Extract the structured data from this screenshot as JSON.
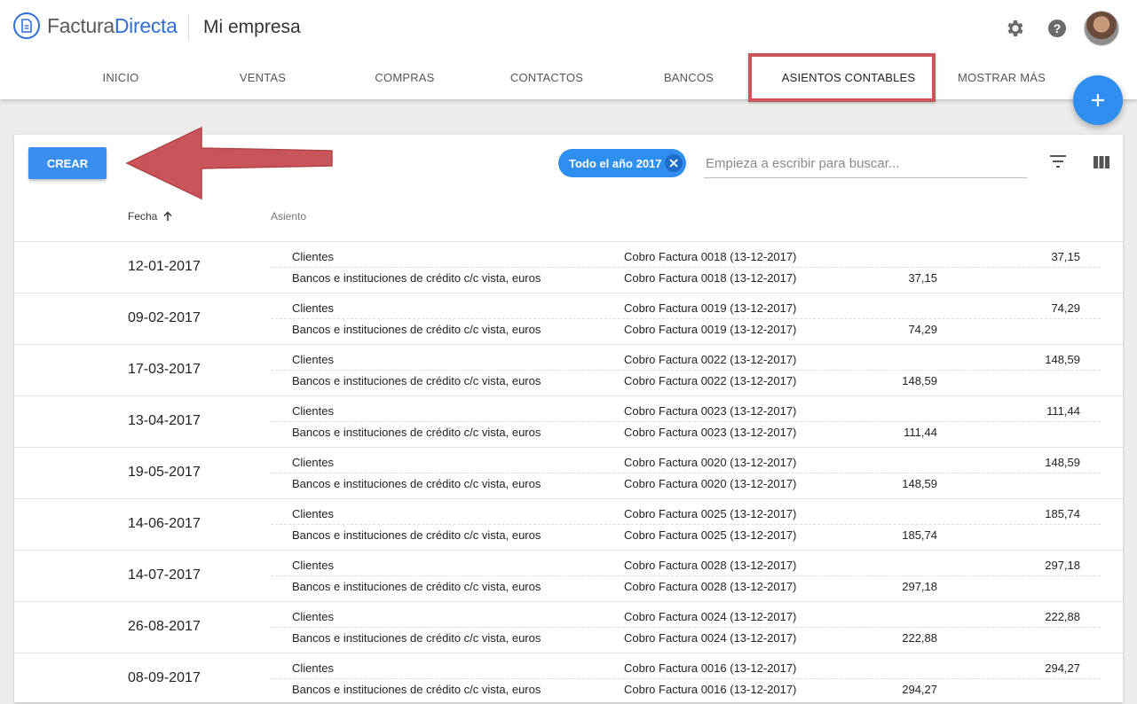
{
  "app": {
    "logo_part1": "Factura",
    "logo_part2": "Directa",
    "company": "Mi empresa"
  },
  "header_icons": [
    "settings-icon",
    "help-icon",
    "avatar"
  ],
  "tabs": [
    {
      "label": "INICIO"
    },
    {
      "label": "VENTAS"
    },
    {
      "label": "COMPRAS"
    },
    {
      "label": "CONTACTOS"
    },
    {
      "label": "BANCOS"
    },
    {
      "label": "ASIENTOS CONTABLES"
    },
    {
      "label": "MOSTRAR MÁS"
    }
  ],
  "active_tab": "ASIENTOS CONTABLES",
  "toolbar": {
    "create_label": "CREAR",
    "filter_chip": "Todo el año 2017",
    "search_placeholder": "Empieza a escribir para buscar..."
  },
  "columns": {
    "fecha": "Fecha",
    "asiento": "Asiento"
  },
  "colors": {
    "accent": "#2f8ff0",
    "annotation": "#c9555a"
  },
  "entries": [
    {
      "date": "12-01-2017",
      "lines": [
        {
          "account": "Clientes",
          "desc": "Cobro Factura 0018 (13-12-2017)",
          "debe": "",
          "haber": "37,15"
        },
        {
          "account": "Bancos e instituciones de crédito c/c vista, euros",
          "desc": "Cobro Factura 0018 (13-12-2017)",
          "debe": "37,15",
          "haber": ""
        }
      ]
    },
    {
      "date": "09-02-2017",
      "lines": [
        {
          "account": "Clientes",
          "desc": "Cobro Factura 0019 (13-12-2017)",
          "debe": "",
          "haber": "74,29"
        },
        {
          "account": "Bancos e instituciones de crédito c/c vista, euros",
          "desc": "Cobro Factura 0019 (13-12-2017)",
          "debe": "74,29",
          "haber": ""
        }
      ]
    },
    {
      "date": "17-03-2017",
      "lines": [
        {
          "account": "Clientes",
          "desc": "Cobro Factura 0022 (13-12-2017)",
          "debe": "",
          "haber": "148,59"
        },
        {
          "account": "Bancos e instituciones de crédito c/c vista, euros",
          "desc": "Cobro Factura 0022 (13-12-2017)",
          "debe": "148,59",
          "haber": ""
        }
      ]
    },
    {
      "date": "13-04-2017",
      "lines": [
        {
          "account": "Clientes",
          "desc": "Cobro Factura 0023 (13-12-2017)",
          "debe": "",
          "haber": "111,44"
        },
        {
          "account": "Bancos e instituciones de crédito c/c vista, euros",
          "desc": "Cobro Factura 0023 (13-12-2017)",
          "debe": "111,44",
          "haber": ""
        }
      ]
    },
    {
      "date": "19-05-2017",
      "lines": [
        {
          "account": "Clientes",
          "desc": "Cobro Factura 0020 (13-12-2017)",
          "debe": "",
          "haber": "148,59"
        },
        {
          "account": "Bancos e instituciones de crédito c/c vista, euros",
          "desc": "Cobro Factura 0020 (13-12-2017)",
          "debe": "148,59",
          "haber": ""
        }
      ]
    },
    {
      "date": "14-06-2017",
      "lines": [
        {
          "account": "Clientes",
          "desc": "Cobro Factura 0025 (13-12-2017)",
          "debe": "",
          "haber": "185,74"
        },
        {
          "account": "Bancos e instituciones de crédito c/c vista, euros",
          "desc": "Cobro Factura 0025 (13-12-2017)",
          "debe": "185,74",
          "haber": ""
        }
      ]
    },
    {
      "date": "14-07-2017",
      "lines": [
        {
          "account": "Clientes",
          "desc": "Cobro Factura 0028 (13-12-2017)",
          "debe": "",
          "haber": "297,18"
        },
        {
          "account": "Bancos e instituciones de crédito c/c vista, euros",
          "desc": "Cobro Factura 0028 (13-12-2017)",
          "debe": "297,18",
          "haber": ""
        }
      ]
    },
    {
      "date": "26-08-2017",
      "lines": [
        {
          "account": "Clientes",
          "desc": "Cobro Factura 0024 (13-12-2017)",
          "debe": "",
          "haber": "222,88"
        },
        {
          "account": "Bancos e instituciones de crédito c/c vista, euros",
          "desc": "Cobro Factura 0024 (13-12-2017)",
          "debe": "222,88",
          "haber": ""
        }
      ]
    },
    {
      "date": "08-09-2017",
      "lines": [
        {
          "account": "Clientes",
          "desc": "Cobro Factura 0016 (13-12-2017)",
          "debe": "",
          "haber": "294,27"
        },
        {
          "account": "Bancos e instituciones de crédito c/c vista, euros",
          "desc": "Cobro Factura 0016 (13-12-2017)",
          "debe": "294,27",
          "haber": ""
        }
      ]
    }
  ]
}
